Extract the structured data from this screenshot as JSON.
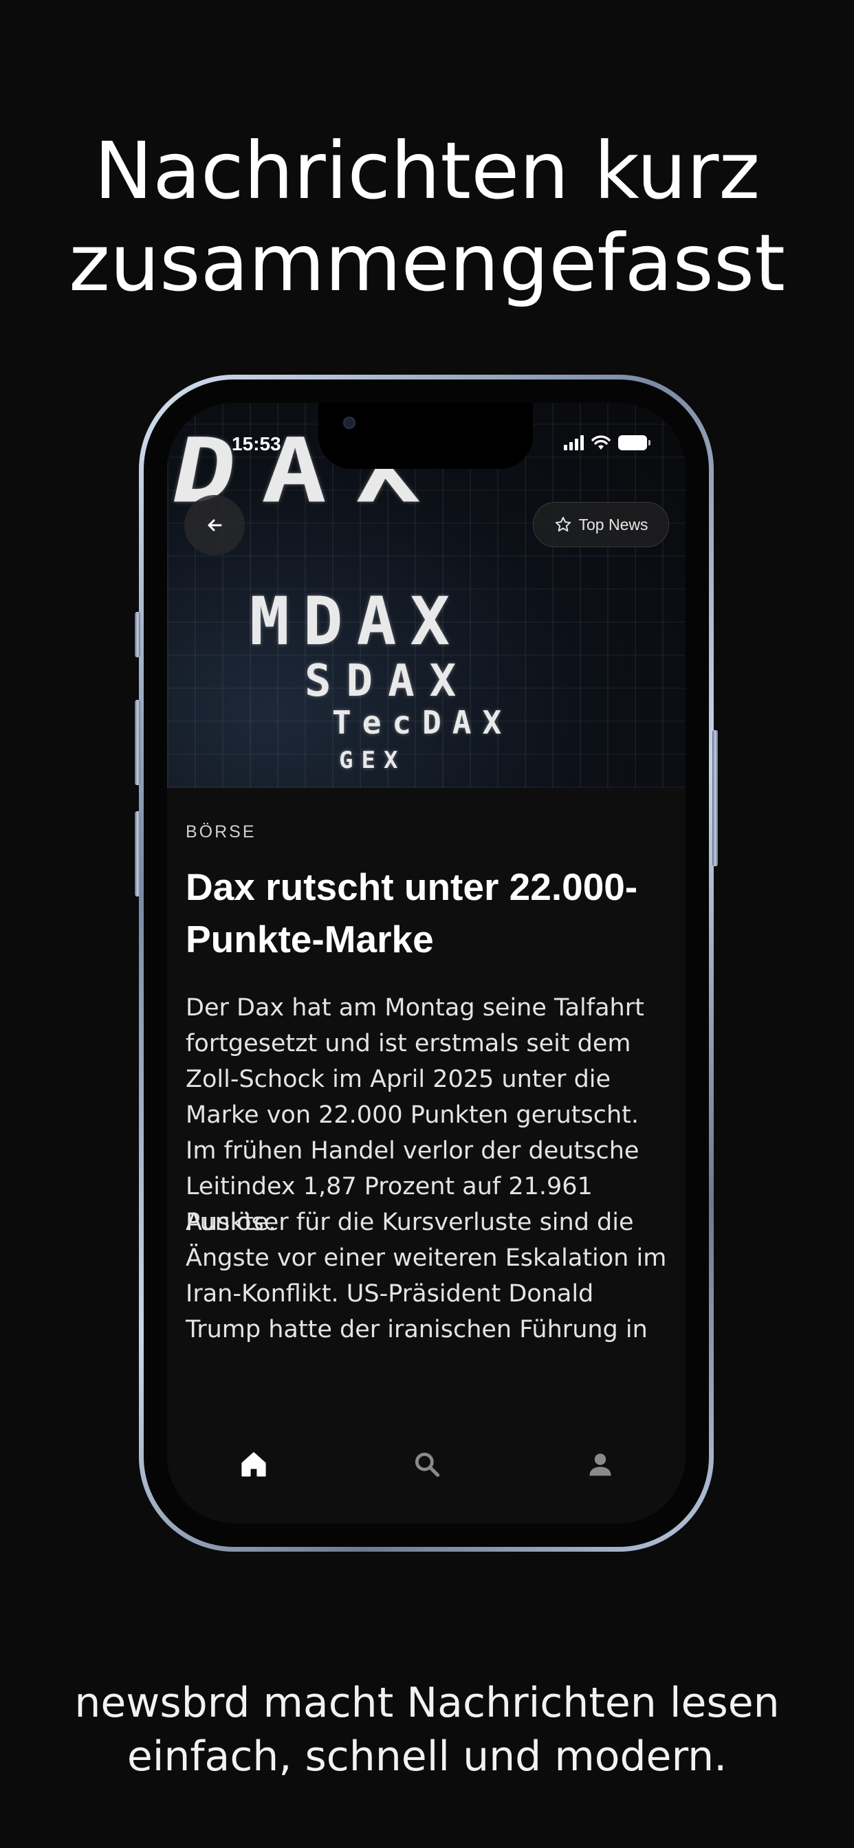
{
  "promo": {
    "headline": [
      "Nachrichten kurz",
      "zusammengefasst"
    ],
    "tagline": [
      "newsbrd macht Nachrichten lesen",
      "einfach, schnell und modern."
    ]
  },
  "status_bar": {
    "time": "15:53"
  },
  "hero": {
    "words": [
      "DAX",
      "MDAX",
      "SDAX",
      "TecDAX",
      "GEX"
    ],
    "badge_label": "Top News",
    "badge_icon": "star-icon",
    "back_icon": "arrow-left-icon"
  },
  "article": {
    "category": "BÖRSE",
    "title": "Dax rutscht unter 22.000-Punkte-Marke",
    "paragraphs": [
      "Der Dax hat am Montag seine Talfahrt fortgesetzt und ist erstmals seit dem Zoll-Schock im April 2025 unter die Marke von 22.000 Punkten gerutscht. Im frühen Handel verlor der deutsche Leitindex 1,87 Prozent auf 21.961 Punkte.",
      "Auslöser für die Kursverluste sind die Ängste vor einer weiteren Eskalation im Iran-Konflikt. US-Präsident Donald Trump hatte der iranischen Führung in"
    ]
  },
  "tabbar": {
    "items": [
      {
        "name": "home",
        "icon": "home-icon",
        "active": true
      },
      {
        "name": "search",
        "icon": "search-icon",
        "active": false
      },
      {
        "name": "profile",
        "icon": "person-icon",
        "active": false
      }
    ],
    "active_color": "#ffffff",
    "inactive_color": "#8a8a8a"
  },
  "colors": {
    "background": "#0b0b0c",
    "screen": "#0e0e0f",
    "frame": "#9aa9c0"
  }
}
